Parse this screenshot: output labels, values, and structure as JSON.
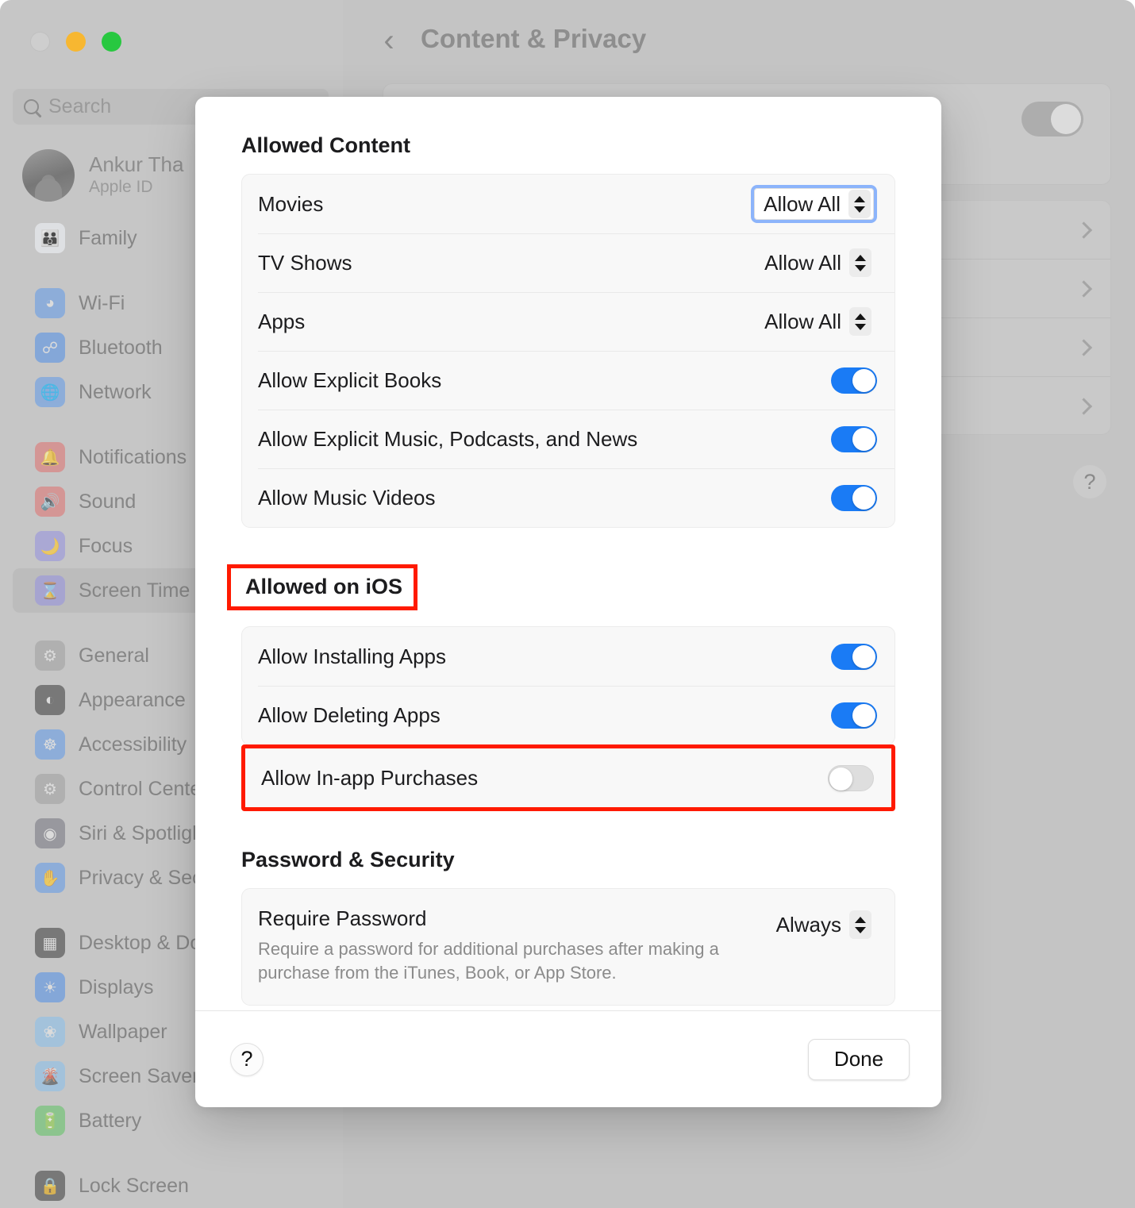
{
  "window": {
    "traffic_lights": [
      "close",
      "minimize",
      "maximize"
    ],
    "search": {
      "placeholder": "Search",
      "value": "",
      "icon": "search-icon"
    },
    "account": {
      "name": "Ankur Tha",
      "subtitle": "Apple ID"
    },
    "sidebar": {
      "groups": [
        {
          "items": [
            {
              "label": "Family",
              "icon": "family-icon",
              "selected": false
            }
          ]
        },
        {
          "items": [
            {
              "label": "Wi-Fi",
              "icon": "wifi-icon",
              "selected": false
            },
            {
              "label": "Bluetooth",
              "icon": "bluetooth-icon",
              "selected": false
            },
            {
              "label": "Network",
              "icon": "network-icon",
              "selected": false
            }
          ]
        },
        {
          "items": [
            {
              "label": "Notifications",
              "icon": "bell-icon",
              "selected": false
            },
            {
              "label": "Sound",
              "icon": "speaker-icon",
              "selected": false
            },
            {
              "label": "Focus",
              "icon": "moon-icon",
              "selected": false
            },
            {
              "label": "Screen Time",
              "icon": "hourglass-icon",
              "selected": true
            }
          ]
        },
        {
          "items": [
            {
              "label": "General",
              "icon": "gear-icon",
              "selected": false
            },
            {
              "label": "Appearance",
              "icon": "contrast-icon",
              "selected": false
            },
            {
              "label": "Accessibility",
              "icon": "accessibility-icon",
              "selected": false
            },
            {
              "label": "Control Cente",
              "icon": "control-center-icon",
              "selected": false
            },
            {
              "label": "Siri & Spotligh",
              "icon": "siri-icon",
              "selected": false
            },
            {
              "label": "Privacy & Sec",
              "icon": "hand-icon",
              "selected": false
            }
          ]
        },
        {
          "items": [
            {
              "label": "Desktop & Do",
              "icon": "desktop-dock-icon",
              "selected": false
            },
            {
              "label": "Displays",
              "icon": "display-icon",
              "selected": false
            },
            {
              "label": "Wallpaper",
              "icon": "wallpaper-icon",
              "selected": false
            },
            {
              "label": "Screen Saver",
              "icon": "screen-saver-icon",
              "selected": false
            },
            {
              "label": "Battery",
              "icon": "battery-icon",
              "selected": false
            }
          ]
        },
        {
          "items": [
            {
              "label": "Lock Screen",
              "icon": "lock-icon",
              "selected": false
            }
          ]
        }
      ]
    }
  },
  "background_page": {
    "back_button": "‹",
    "title": "Content & Privacy",
    "top_toggle_state": "off",
    "disclosure_rows": 4,
    "help_button": "?"
  },
  "dialog": {
    "sections": [
      {
        "heading": "Allowed Content",
        "highlighted": false,
        "rows": [
          {
            "label": "Movies",
            "control": "popup",
            "value": "Allow All",
            "focused": true
          },
          {
            "label": "TV Shows",
            "control": "popup",
            "value": "Allow All",
            "focused": false
          },
          {
            "label": "Apps",
            "control": "popup",
            "value": "Allow All",
            "focused": false
          },
          {
            "label": "Allow Explicit Books",
            "control": "switch",
            "state": "on"
          },
          {
            "label": "Allow Explicit Music, Podcasts, and News",
            "control": "switch",
            "state": "on"
          },
          {
            "label": "Allow Music Videos",
            "control": "switch",
            "state": "on"
          }
        ]
      },
      {
        "heading": "Allowed on iOS",
        "highlighted": true,
        "rows": [
          {
            "label": "Allow Installing Apps",
            "control": "switch",
            "state": "on"
          },
          {
            "label": "Allow Deleting Apps",
            "control": "switch",
            "state": "on"
          },
          {
            "label": "Allow In-app Purchases",
            "control": "switch",
            "state": "off",
            "highlighted": true
          }
        ]
      },
      {
        "heading": "Password & Security",
        "highlighted": false,
        "rows": [
          {
            "label": "Require Password",
            "control": "popup",
            "value": "Always",
            "focused": false,
            "description": "Require a password for additional purchases after making a purchase from the iTunes, Book, or App Store."
          }
        ]
      }
    ],
    "footer": {
      "help_label": "?",
      "done_label": "Done"
    }
  },
  "colors": {
    "switch_on": "#1a7bf5",
    "switch_off": "#dedede",
    "focus_ring": "#8cb4fb",
    "annotation": "#ff1a00",
    "card_bg": "#f8f8f8",
    "dialog_bg": "#ffffff",
    "dimmed_chrome": "#c6c6c6"
  }
}
